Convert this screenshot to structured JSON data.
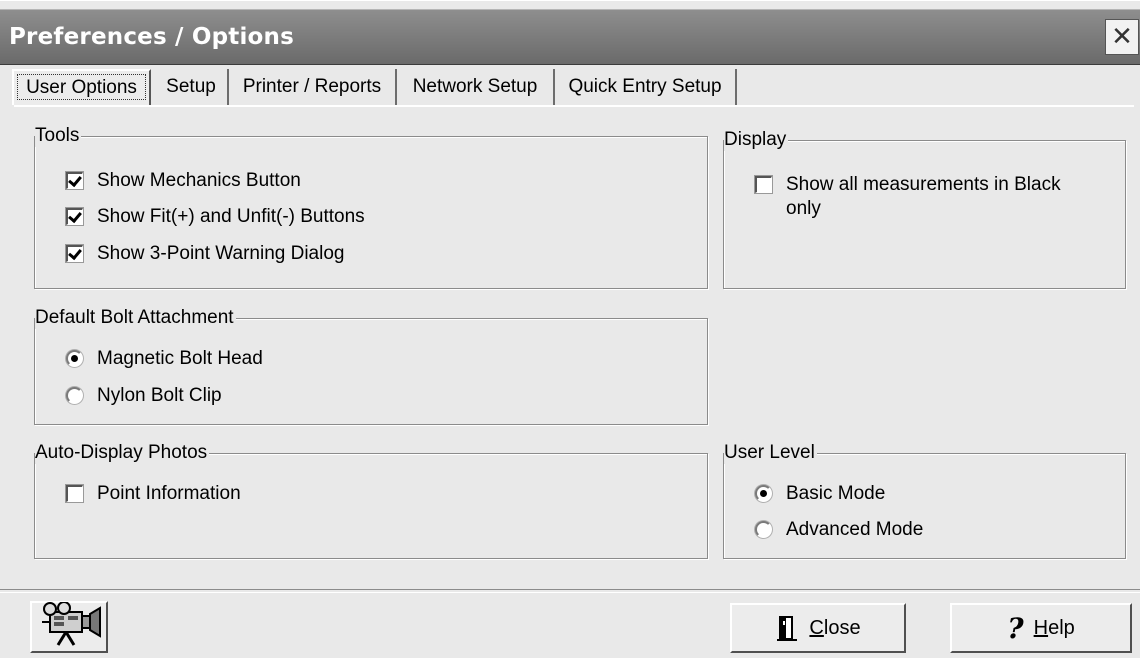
{
  "window": {
    "title": "Preferences / Options",
    "close_glyph": "✕"
  },
  "tabs": [
    {
      "label": "User Options",
      "active": true
    },
    {
      "label": "Setup",
      "active": false
    },
    {
      "label": "Printer / Reports",
      "active": false
    },
    {
      "label": "Network Setup",
      "active": false
    },
    {
      "label": "Quick Entry Setup",
      "active": false
    }
  ],
  "tools": {
    "legend": "Tools",
    "items": [
      {
        "label": "Show Mechanics Button",
        "checked": true
      },
      {
        "label": "Show Fit(+) and Unfit(-) Buttons",
        "checked": true
      },
      {
        "label": "Show 3-Point Warning Dialog",
        "checked": true
      }
    ]
  },
  "display": {
    "legend": "Display",
    "items": [
      {
        "label": "Show all measurements in Black only",
        "checked": false
      }
    ]
  },
  "bolt_attachment": {
    "legend": "Default Bolt Attachment",
    "options": [
      {
        "label": "Magnetic Bolt Head",
        "selected": true
      },
      {
        "label": "Nylon Bolt Clip",
        "selected": false
      }
    ]
  },
  "auto_display_photos": {
    "legend": "Auto-Display Photos",
    "items": [
      {
        "label": "Point Information",
        "checked": false
      }
    ]
  },
  "user_level": {
    "legend": "User Level",
    "options": [
      {
        "label": "Basic Mode",
        "selected": true
      },
      {
        "label": "Advanced Mode",
        "selected": false
      }
    ]
  },
  "buttons": {
    "camera_icon": "video-camera-icon",
    "close_mnemonic": "C",
    "close_rest": "lose",
    "close_icon": "door-exit-icon",
    "help_mnemonic": "H",
    "help_rest": "elp",
    "help_icon": "question-mark-icon",
    "help_glyph": "?"
  }
}
